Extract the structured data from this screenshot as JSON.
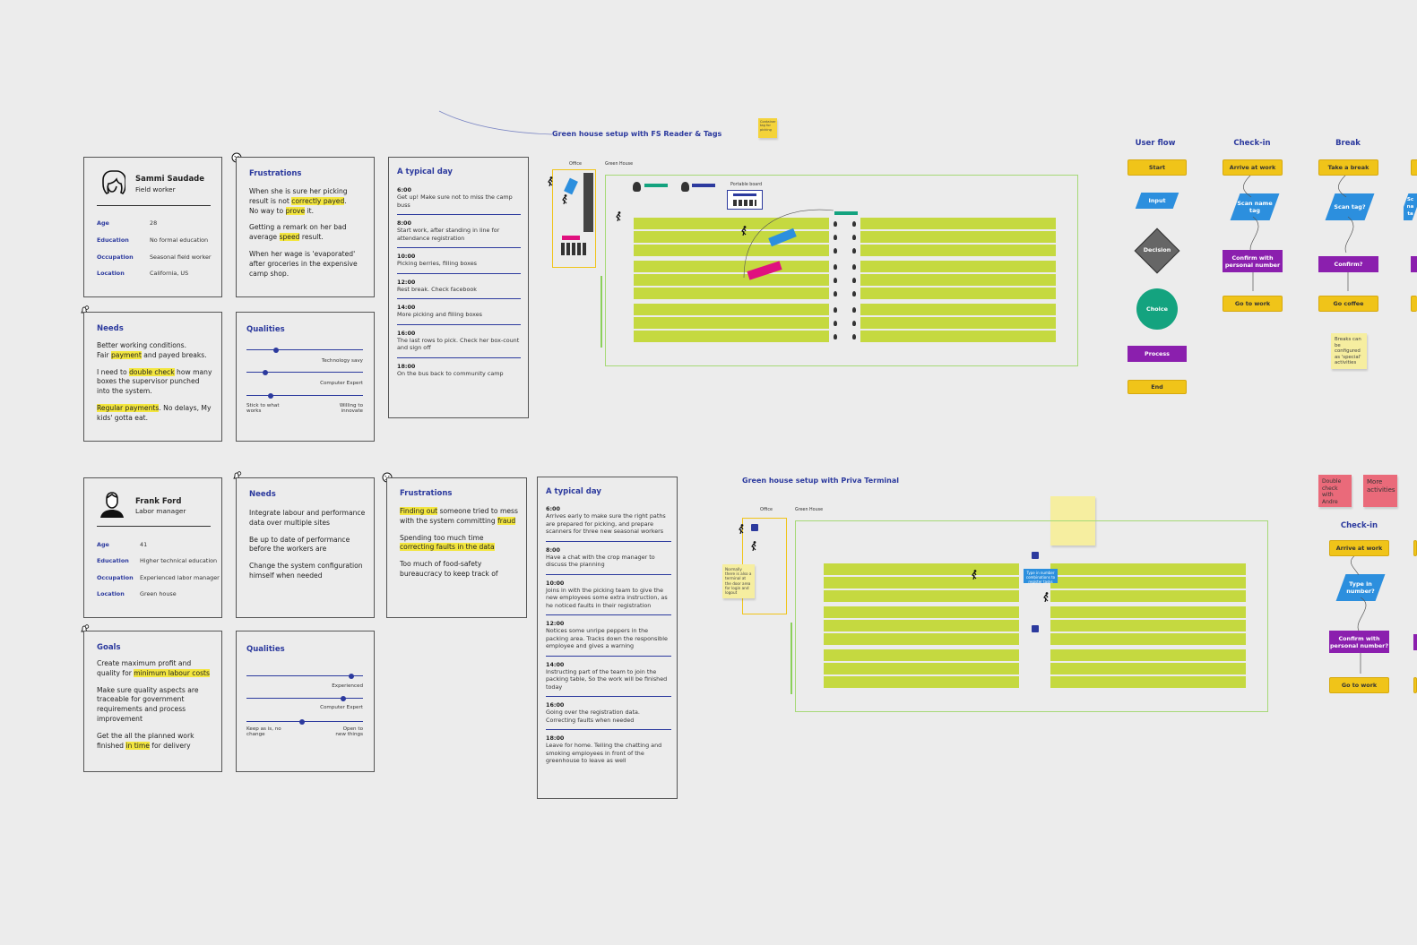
{
  "persona1": {
    "name": "Sammi Saudade",
    "role": "Field worker",
    "attributes": [
      {
        "label": "Age",
        "value": "28"
      },
      {
        "label": "Education",
        "value": "No formal education"
      },
      {
        "label": "Occupation",
        "value": "Seasonal field worker"
      },
      {
        "label": "Location",
        "value": "California, US"
      }
    ],
    "frustrations": {
      "title": "Frustrations",
      "p1a": "When she is sure her picking result is not ",
      "p1b": "correctly payed",
      "p1c": ".",
      "p1d": "No way to ",
      "p1e": "prove",
      "p1f": " it.",
      "p2a": "Getting a remark on her bad average ",
      "p2b": "speed",
      "p2c": " result.",
      "p3": "When her wage is 'evaporated' after groceries in the expensive camp shop."
    },
    "needs": {
      "title": "Needs",
      "p1a": "Better working conditions.",
      "p1b": "Fair ",
      "p1c": "payment",
      "p1d": " and payed breaks.",
      "p2a": "I need to ",
      "p2b": "double check",
      "p2c": " how many boxes the supervisor punched into the system.",
      "p3a": "Regular payments",
      "p3b": ". No delays, My kids' gotta eat."
    },
    "qualities": {
      "title": "Qualities",
      "s1_label": "Technology savy",
      "s1_level": 0.25,
      "s2_label": "Computer Expert",
      "s2_level": 0.16,
      "s3_level": 0.21,
      "left_label": "Stick to what works",
      "right_label": "Willing to innovate"
    },
    "day": {
      "title": "A typical day",
      "items": [
        {
          "time": "6:00",
          "text": "Get up! Make sure not to miss the camp buss"
        },
        {
          "time": "8:00",
          "text": "Start work, after standing in line for attendance registration"
        },
        {
          "time": "10:00",
          "text": "Picking berries, filling boxes"
        },
        {
          "time": "12:00",
          "text": "Rest break. Check facebook"
        },
        {
          "time": "14:00",
          "text": "More picking and filling boxes"
        },
        {
          "time": "16:00",
          "text": "The last rows to pick. Check her box-count and sign off"
        },
        {
          "time": "18:00",
          "text": "On the bus back to community camp"
        }
      ]
    }
  },
  "persona2": {
    "name": "Frank Ford",
    "role": "Labor manager",
    "attributes": [
      {
        "label": "Age",
        "value": "41"
      },
      {
        "label": "Education",
        "value": "Higher technical education"
      },
      {
        "label": "Occupation",
        "value": "Experienced labor manager"
      },
      {
        "label": "Location",
        "value": "Green house"
      }
    ],
    "needs": {
      "title": "Needs",
      "p1": "Integrate labour and performance data over multiple sites",
      "p2": "Be up to date of performance before the workers are",
      "p3": "Change the system configuration himself when needed"
    },
    "frustrations": {
      "title": "Frustrations",
      "p1a": "Finding out",
      "p1b": " someone tried to mess with the system committing ",
      "p1c": "fraud",
      "p2a": "Spending too much time ",
      "p2b": "correcting faults in the data",
      "p3": "Too much of food-safety bureaucracy to keep track of"
    },
    "goals": {
      "title": "Goals",
      "p1a": "Create maximum profit and quality for ",
      "p1b": "minimum labour costs",
      "p2": "Make sure quality aspects are traceable for government requirements and process improvement",
      "p3a": "Get the all the planned work finished ",
      "p3b": "in time",
      "p3c": " for delivery"
    },
    "qualities": {
      "title": "Qualities",
      "s1_label": "Experienced",
      "s1_level": 0.9,
      "s2_label": "Computer Expert",
      "s2_level": 0.83,
      "s3_level": 0.48,
      "left_label": "Keep as is, no change",
      "right_label": "Open to new things"
    },
    "day": {
      "title": "A typical day",
      "items": [
        {
          "time": "6:00",
          "text": "Arrives early to make sure the right paths are prepared for picking, and prepare scanners for three new seasonal workers"
        },
        {
          "time": "8:00",
          "text": "Have a chat with the crop manager to discuss the planning"
        },
        {
          "time": "10:00",
          "text": "Joins in with the picking team to give the new employees some extra instruction, as he noticed faults in their registration"
        },
        {
          "time": "12:00",
          "text": "Notices some unripe peppers in the packing area. Tracks down the responsible employee and gives a warning"
        },
        {
          "time": "14:00",
          "text": "Instructing part of the team to join the packing table, So the work will be finished today"
        },
        {
          "time": "16:00",
          "text": "Going over the registration data. Correcting faults when needed"
        },
        {
          "time": "18:00",
          "text": "Leave for home. Telling the chatting and smoking employees in front of the greenhouse to leave as well"
        }
      ]
    }
  },
  "gh1": {
    "title": "Green house setup with FS Reader & Tags",
    "office": "Office",
    "greenhouse": "Green House",
    "portable": "Portable board",
    "sticky": "Container tag for picking"
  },
  "gh2": {
    "title": "Green house setup with Priva Terminal",
    "office": "Office",
    "greenhouse": "Green House",
    "note_left": "Normally there is also a terminal at the door area for login and logout",
    "note_blue": "Type in number combinations to register tasks"
  },
  "flow": {
    "user_flow": "User flow",
    "legend": [
      "Start",
      "Input",
      "Decision",
      "Choice",
      "Process",
      "End"
    ],
    "checkin_title": "Check-in",
    "checkin": [
      "Arrive at work",
      "Scan name tag",
      "Confirm with personal number",
      "Go to work"
    ],
    "break_title": "Break",
    "break": [
      "Take a break",
      "Scan tag?",
      "Confirm?",
      "Go coffee"
    ],
    "break_note": "Breaks can be configured as 'special' activities",
    "col4_partial": "Sc na ta",
    "checkin2_title": "Check-in",
    "checkin2": [
      "Arrive at work",
      "Type in number?",
      "Confirm with personal number?",
      "Go to work"
    ],
    "sticky_red1": "Double check with Andre",
    "sticky_red2": "More activities"
  },
  "colors": {
    "accent": "#2c3a9e",
    "highlight": "#f3e63f",
    "row": "#c5d940",
    "process": "#8b1fae",
    "input": "#2c8fde",
    "start": "#f0c419",
    "choice": "#14a37f"
  }
}
